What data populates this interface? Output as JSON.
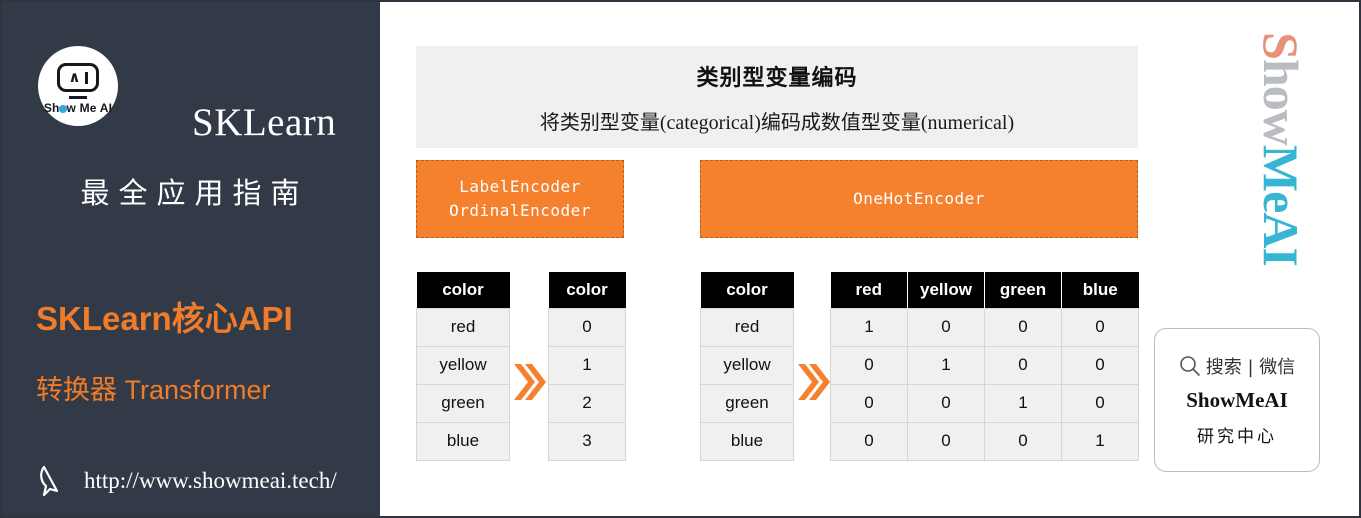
{
  "sidebar": {
    "logo": {
      "icon": "show-me-ai-robot-logo",
      "text_before_dot": "Sh",
      "dot": "o",
      "text_after_dot": "w Me AI"
    },
    "brand_title": "SKLearn",
    "brand_subtitle": "最全应用指南",
    "accent_line_1": "SKLearn核心API",
    "accent_line_2": "转换器 Transformer",
    "cursor_icon": "mouse-pointer-icon",
    "url": "http://www.showmeai.tech/",
    "colors": {
      "background": "#323a47",
      "accent": "#f07c2a",
      "text": "#ffffff"
    }
  },
  "header": {
    "title": "类别型变量编码",
    "subtitle": "将类别型变量(categorical)编码成数值型变量(numerical)",
    "background": "#f0f0f0"
  },
  "encoders": [
    {
      "id": "label-ordinal",
      "lines": [
        "LabelEncoder",
        "OrdinalEncoder"
      ],
      "color": "#f5812f"
    },
    {
      "id": "onehot",
      "lines": [
        "OneHotEncoder"
      ],
      "color": "#f5812f"
    }
  ],
  "arrow_icon": "double-chevron-right-icon",
  "tables": {
    "label_input": {
      "headers": [
        "color"
      ],
      "rows": [
        [
          "red"
        ],
        [
          "yellow"
        ],
        [
          "green"
        ],
        [
          "blue"
        ]
      ]
    },
    "label_output": {
      "headers": [
        "color"
      ],
      "rows": [
        [
          "0"
        ],
        [
          "1"
        ],
        [
          "2"
        ],
        [
          "3"
        ]
      ]
    },
    "onehot_input": {
      "headers": [
        "color"
      ],
      "rows": [
        [
          "red"
        ],
        [
          "yellow"
        ],
        [
          "green"
        ],
        [
          "blue"
        ]
      ]
    },
    "onehot_output": {
      "headers": [
        "red",
        "yellow",
        "green",
        "blue"
      ],
      "rows": [
        [
          "1",
          "0",
          "0",
          "0"
        ],
        [
          "0",
          "1",
          "0",
          "0"
        ],
        [
          "0",
          "0",
          "1",
          "0"
        ],
        [
          "0",
          "0",
          "0",
          "1"
        ]
      ]
    }
  },
  "watermark": {
    "part_1": "S",
    "part_2": "how",
    "part_3": "MeAI",
    "colors": {
      "part_1": "#e8917a",
      "part_2": "#b9bcc0",
      "part_3": "#37b6d3"
    }
  },
  "search_card": {
    "search_icon": "magnifier-icon",
    "search_label": "搜索 | 微信",
    "brand": "ShowMeAI",
    "sub": "研究中心"
  }
}
